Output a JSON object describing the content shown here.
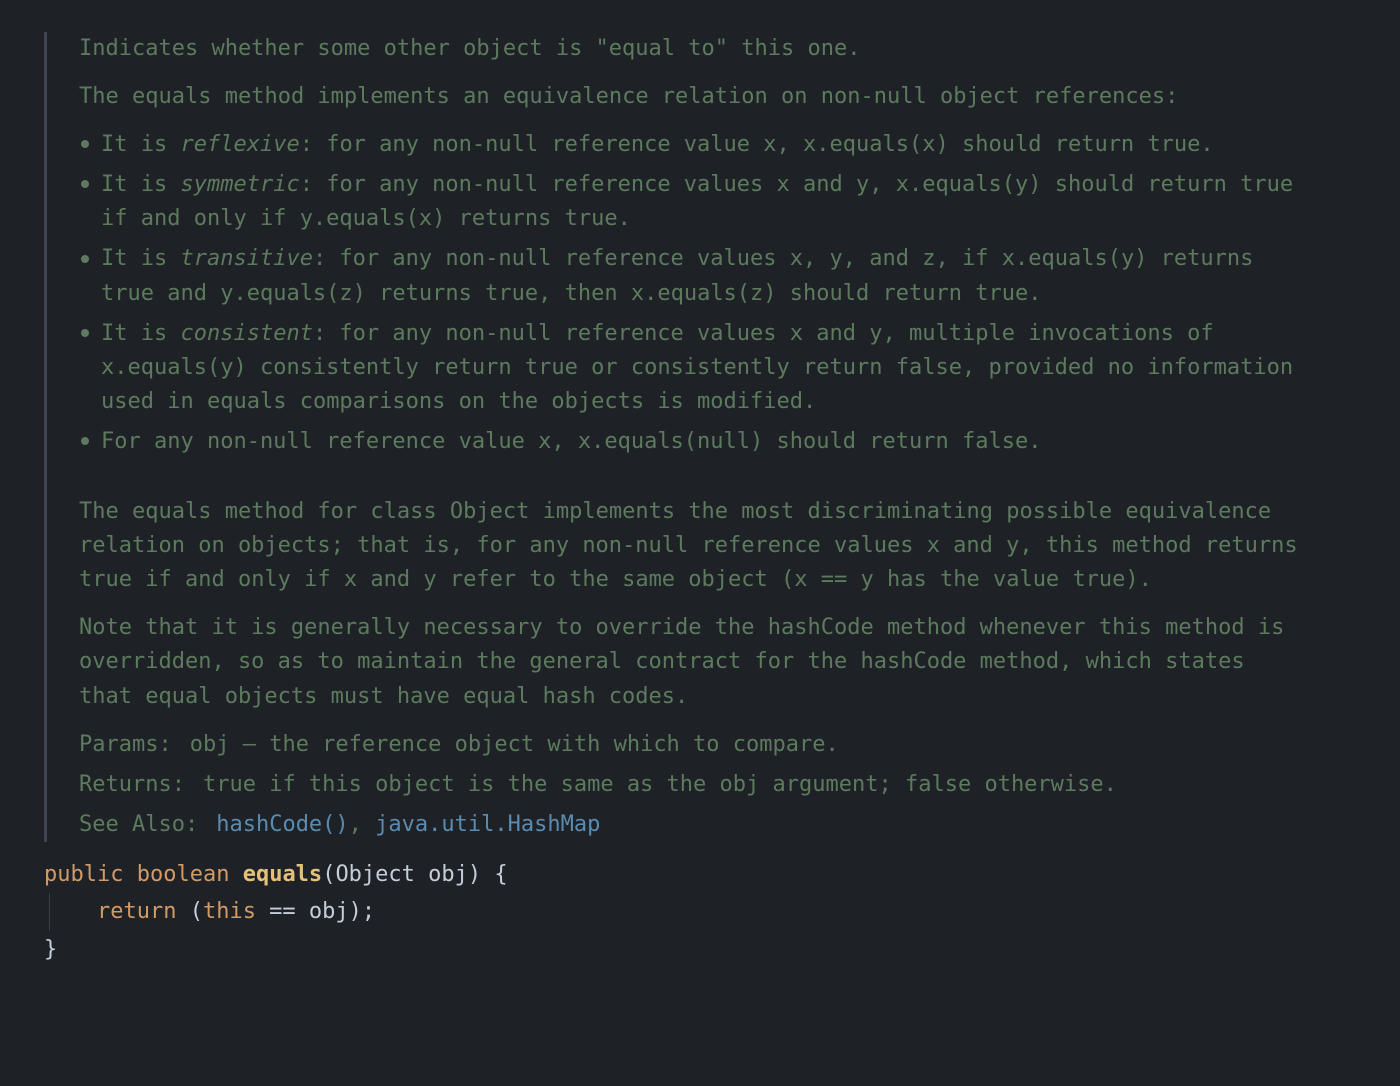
{
  "doc": {
    "p_intro": "Indicates whether some other object is \"equal to\" this one.",
    "p_relation_pre": "The ",
    "p_relation_code": "equals",
    "p_relation_post": " method implements an equivalence relation on non-null object references:",
    "bullets": {
      "reflexive": {
        "pre": "It is ",
        "em": "reflexive",
        "t1": ": for any non-null reference value ",
        "c1": "x",
        "t2": ", ",
        "c2": "x.equals(x)",
        "t3": " should return ",
        "c3": "true",
        "t4": "."
      },
      "symmetric": {
        "pre": "It is ",
        "em": "symmetric",
        "t1": ": for any non-null reference values ",
        "c1": "x",
        "t2": " and ",
        "c2": "y",
        "t3": ", ",
        "c3": "x.equals(y)",
        "t4": " should return ",
        "c4": "true",
        "t5": " if and only if ",
        "c5": "y.equals(x)",
        "t6": " returns ",
        "c6": "true",
        "t7": "."
      },
      "transitive": {
        "pre": "It is ",
        "em": "transitive",
        "t1": ": for any non-null reference values ",
        "c1": "x",
        "t2": ", ",
        "c2": "y",
        "t3": ", and ",
        "c3": "z",
        "t4": ", if ",
        "c4": "x.equals(y)",
        "t5": " returns ",
        "c5": "true",
        "t6": " and ",
        "c6": "y.equals(z)",
        "t7": " returns ",
        "c7": "true",
        "t8": ", then ",
        "c8": "x.equals(z)",
        "t9": " should return ",
        "c9": "true",
        "t10": "."
      },
      "consistent": {
        "pre": "It is ",
        "em": "consistent",
        "t1": ": for any non-null reference values ",
        "c1": "x",
        "t2": " and ",
        "c2": "y",
        "t3": ", multiple invocations of ",
        "c3": "x.equals(y)",
        "t4": " consistently return ",
        "c4": "true",
        "t5": " or consistently return ",
        "c5": "false",
        "t6": ", provided no information used in ",
        "c6": "equals",
        "t7": " comparisons on the objects is modified."
      },
      "nonnull": {
        "t1": "For any non-null reference value ",
        "c1": "x",
        "t2": ", ",
        "c2": "x.equals(null)",
        "t3": " should return ",
        "c3": "false",
        "t4": "."
      }
    },
    "p_default": {
      "t1": "The ",
      "c1": "equals",
      "t2": " method for class ",
      "c2": "Object",
      "t3": " implements the most discriminating possible equivalence relation on objects; that is, for any non-null reference values ",
      "c3": "x",
      "t4": " and ",
      "c4": "y",
      "t5": ", this method returns ",
      "c5": "true",
      "t6": " if and only if ",
      "c6": "x",
      "t7": " and ",
      "c7": "y",
      "t8": " refer to the same object (",
      "c8": "x == y",
      "t9": " has the value ",
      "c9": "true",
      "t10": ")."
    },
    "p_note": {
      "t1": "Note that it is generally necessary to override the ",
      "c1": "hashCode",
      "t2": " method whenever this method is overridden, so as to maintain the general contract for the ",
      "c2": "hashCode",
      "t3": " method, which states that equal objects must have equal hash codes."
    },
    "params": {
      "label": "Params:",
      "t1": "obj",
      "t2": " – the reference object with which to compare."
    },
    "returns": {
      "label": "Returns:",
      "c1": "true",
      "t1": " if this object is the same as the obj argument; ",
      "c2": "false",
      "t2": " otherwise."
    },
    "see_also": {
      "label": "See Also:",
      "link1": "hashCode()",
      "sep": ", ",
      "link2": "java.util.HashMap"
    }
  },
  "code": {
    "kw_public": "public",
    "kw_boolean": "boolean",
    "fn_equals": "equals",
    "lparen": "(",
    "cls_object": "Object",
    "sp": " ",
    "param_obj": "obj",
    "rparen_brace": ") {",
    "kw_return": "return",
    "lparen2": " (",
    "kw_this": "this",
    "op_eq": " == ",
    "ident_obj": "obj",
    "rparen_semi": ");",
    "rbrace": "}"
  }
}
